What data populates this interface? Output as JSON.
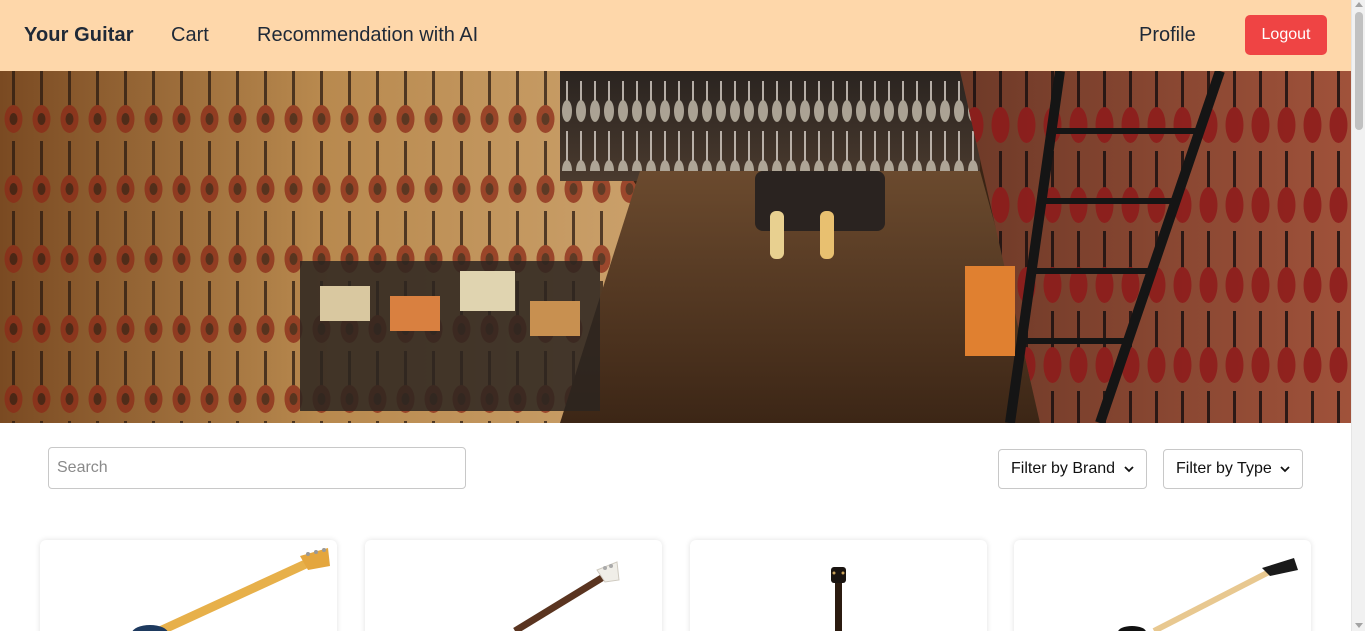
{
  "nav": {
    "brand": "Your Guitar",
    "cart": "Cart",
    "ai": "Recommendation with AI",
    "profile": "Profile",
    "logout": "Logout"
  },
  "colors": {
    "navbar": "#fed7aa",
    "logout": "#ef4444"
  },
  "hero": {
    "image": "guitar-store-photo"
  },
  "filters": {
    "search_placeholder": "Search",
    "search_value": "",
    "brand": "Filter by Brand",
    "type": "Filter by Type"
  },
  "products": [
    {
      "image": "blue-electric-guitar"
    },
    {
      "image": "white-electric-guitar"
    },
    {
      "image": "classical-guitar"
    },
    {
      "image": "black-superstrat-guitar"
    }
  ]
}
